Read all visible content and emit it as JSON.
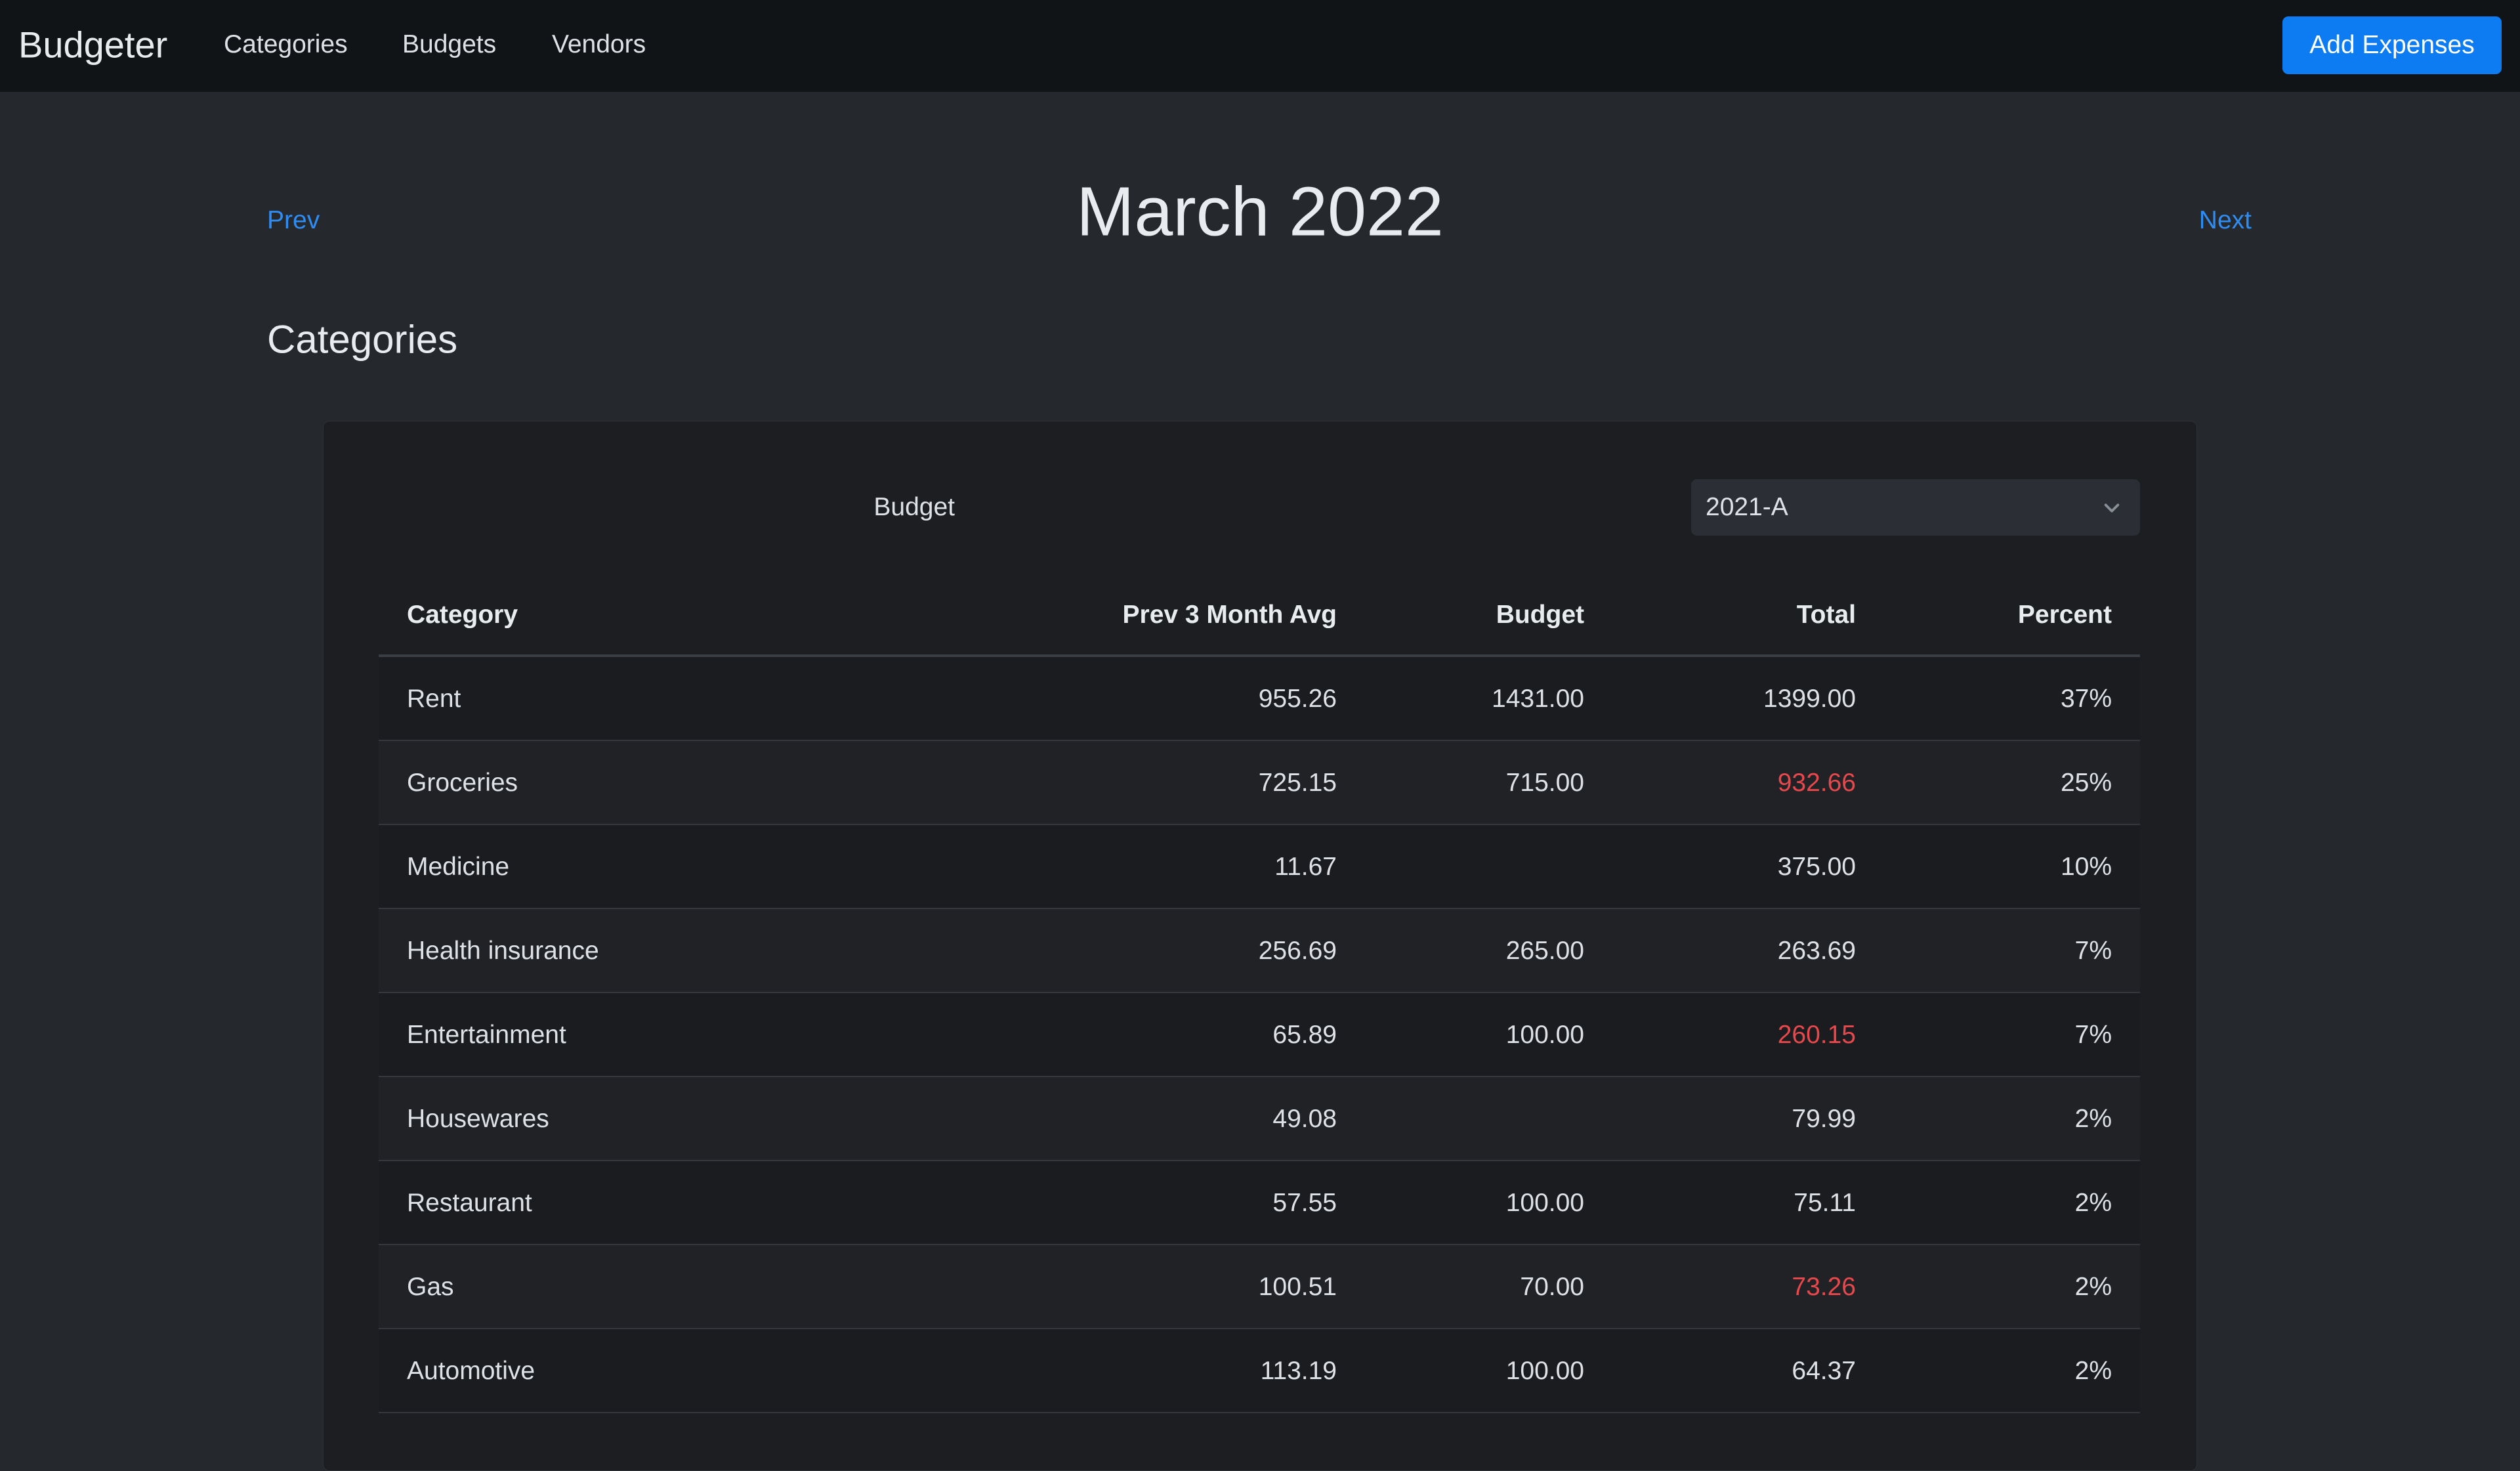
{
  "navbar": {
    "brand": "Budgeter",
    "links": [
      "Categories",
      "Budgets",
      "Vendors"
    ],
    "add_button": "Add Expenses"
  },
  "pager": {
    "prev": "Prev",
    "title": "March 2022",
    "next": "Next"
  },
  "section_title": "Categories",
  "budget_filter": {
    "label": "Budget",
    "selected": "2021-A"
  },
  "table": {
    "headers": [
      "Category",
      "Prev 3 Month Avg",
      "Budget",
      "Total",
      "Percent"
    ],
    "rows": [
      {
        "category": "Rent",
        "prev_avg": "955.26",
        "budget": "1431.00",
        "total": "1399.00",
        "percent": "37%",
        "over_budget": false
      },
      {
        "category": "Groceries",
        "prev_avg": "725.15",
        "budget": "715.00",
        "total": "932.66",
        "percent": "25%",
        "over_budget": true
      },
      {
        "category": "Medicine",
        "prev_avg": "11.67",
        "budget": "",
        "total": "375.00",
        "percent": "10%",
        "over_budget": false
      },
      {
        "category": "Health insurance",
        "prev_avg": "256.69",
        "budget": "265.00",
        "total": "263.69",
        "percent": "7%",
        "over_budget": false
      },
      {
        "category": "Entertainment",
        "prev_avg": "65.89",
        "budget": "100.00",
        "total": "260.15",
        "percent": "7%",
        "over_budget": true
      },
      {
        "category": "Housewares",
        "prev_avg": "49.08",
        "budget": "",
        "total": "79.99",
        "percent": "2%",
        "over_budget": false
      },
      {
        "category": "Restaurant",
        "prev_avg": "57.55",
        "budget": "100.00",
        "total": "75.11",
        "percent": "2%",
        "over_budget": false
      },
      {
        "category": "Gas",
        "prev_avg": "100.51",
        "budget": "70.00",
        "total": "73.26",
        "percent": "2%",
        "over_budget": true
      },
      {
        "category": "Automotive",
        "prev_avg": "113.19",
        "budget": "100.00",
        "total": "64.37",
        "percent": "2%",
        "over_budget": false
      }
    ]
  },
  "colors": {
    "background": "#25282d",
    "navbar": "#111417",
    "accent": "#0d7cf2",
    "link": "#2f8cf0",
    "over_budget": "#e8484c"
  }
}
